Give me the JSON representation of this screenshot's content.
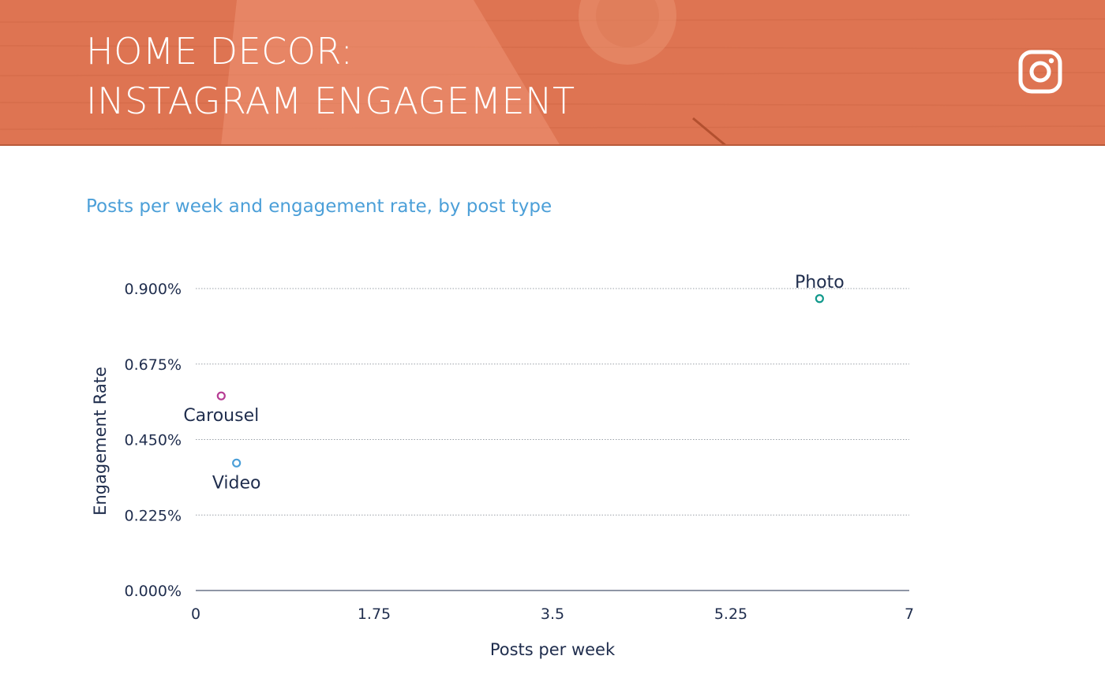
{
  "header": {
    "title_line1": "HOME DECOR:",
    "title_line2": "INSTAGRAM ENGAGEMENT",
    "icon": "instagram-icon",
    "background_color": "#de7452"
  },
  "subtitle": "Posts per week and engagement rate, by post type",
  "chart_data": {
    "type": "scatter",
    "title": "Posts per week and engagement rate, by post type",
    "xlabel": "Posts per week",
    "ylabel": "Engagement Rate",
    "xlim": [
      0,
      7
    ],
    "ylim": [
      0,
      0.9
    ],
    "x_ticks": [
      0,
      1.75,
      3.5,
      5.25,
      7
    ],
    "x_tick_labels": [
      "0",
      "1.75",
      "3.5",
      "5.25",
      "7"
    ],
    "y_ticks": [
      0,
      0.225,
      0.45,
      0.675,
      0.9
    ],
    "y_tick_labels": [
      "0.000%",
      "0.225%",
      "0.450%",
      "0.675%",
      "0.900%"
    ],
    "grid": true,
    "points": [
      {
        "label": "Photo",
        "x": 6.12,
        "y": 0.87,
        "color": "#12998c",
        "label_position": "above"
      },
      {
        "label": "Carousel",
        "x": 0.25,
        "y": 0.58,
        "color": "#b63b93",
        "label_position": "below"
      },
      {
        "label": "Video",
        "x": 0.4,
        "y": 0.38,
        "color": "#4b9fd8",
        "label_position": "below"
      }
    ]
  }
}
